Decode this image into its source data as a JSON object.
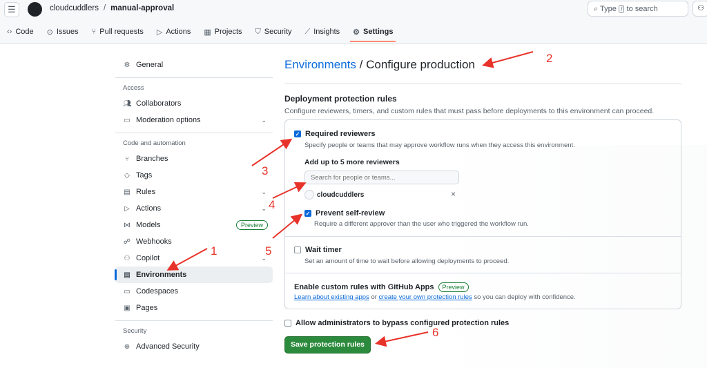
{
  "header": {
    "owner": "cloudcuddlers",
    "separator": "/",
    "repo": "manual-approval",
    "search_prefix": "Type",
    "search_key": "/",
    "search_suffix": "to search"
  },
  "nav": [
    {
      "icon": "code-icon",
      "glyph": "‹›",
      "label": "Code"
    },
    {
      "icon": "issues-icon",
      "glyph": "⊙",
      "label": "Issues"
    },
    {
      "icon": "pull-request-icon",
      "glyph": "⑂",
      "label": "Pull requests"
    },
    {
      "icon": "actions-icon",
      "glyph": "▷",
      "label": "Actions"
    },
    {
      "icon": "projects-icon",
      "glyph": "▦",
      "label": "Projects"
    },
    {
      "icon": "security-icon",
      "glyph": "⛉",
      "label": "Security"
    },
    {
      "icon": "insights-icon",
      "glyph": "⟋",
      "label": "Insights"
    },
    {
      "icon": "gear-icon",
      "glyph": "⚙",
      "label": "Settings",
      "selected": true
    }
  ],
  "sidebar": {
    "general": "General",
    "access_heading": "Access",
    "collaborators": "Collaborators",
    "moderation": "Moderation options",
    "code_heading": "Code and automation",
    "branches": "Branches",
    "tags": "Tags",
    "rules": "Rules",
    "actions": "Actions",
    "models": "Models",
    "models_badge": "Preview",
    "webhooks": "Webhooks",
    "copilot": "Copilot",
    "environments": "Environments",
    "codespaces": "Codespaces",
    "pages": "Pages",
    "security_heading": "Security",
    "advanced_security": "Advanced Security"
  },
  "main": {
    "breadcrumb_link": "Environments",
    "title": " / Configure production",
    "section_title": "Deployment protection rules",
    "section_desc": "Configure reviewers, timers, and custom rules that must pass before deployments to this environment can proceed.",
    "required_reviewers": {
      "label": "Required reviewers",
      "checked": true,
      "desc": "Specify people or teams that may approve workflow runs when they access this environment."
    },
    "add_reviewers_label": "Add up to 5 more reviewers",
    "search_placeholder": "Search for people or teams...",
    "reviewer": "cloudcuddlers",
    "prevent_self_review": {
      "label": "Prevent self-review",
      "checked": true,
      "desc": "Require a different approver than the user who triggered the workflow run."
    },
    "wait_timer": {
      "label": "Wait timer",
      "checked": false,
      "desc": "Set an amount of time to wait before allowing deployments to proceed."
    },
    "custom_rules_title": "Enable custom rules with GitHub Apps",
    "custom_rules_badge": "Preview",
    "link1": "Learn about existing apps",
    "or": " or ",
    "link2": "create your own protection rules",
    "custom_rules_tail": " so you can deploy with confidence.",
    "bypass": {
      "label": "Allow administrators to bypass configured protection rules",
      "checked": false
    },
    "save_button": "Save protection rules"
  },
  "annotations": [
    "1",
    "2",
    "3",
    "4",
    "5",
    "6"
  ],
  "colors": {
    "accent": "#0969da",
    "save": "#2c8a3c",
    "arrow": "#e8332a",
    "tab_underline": "#fd8c73"
  }
}
